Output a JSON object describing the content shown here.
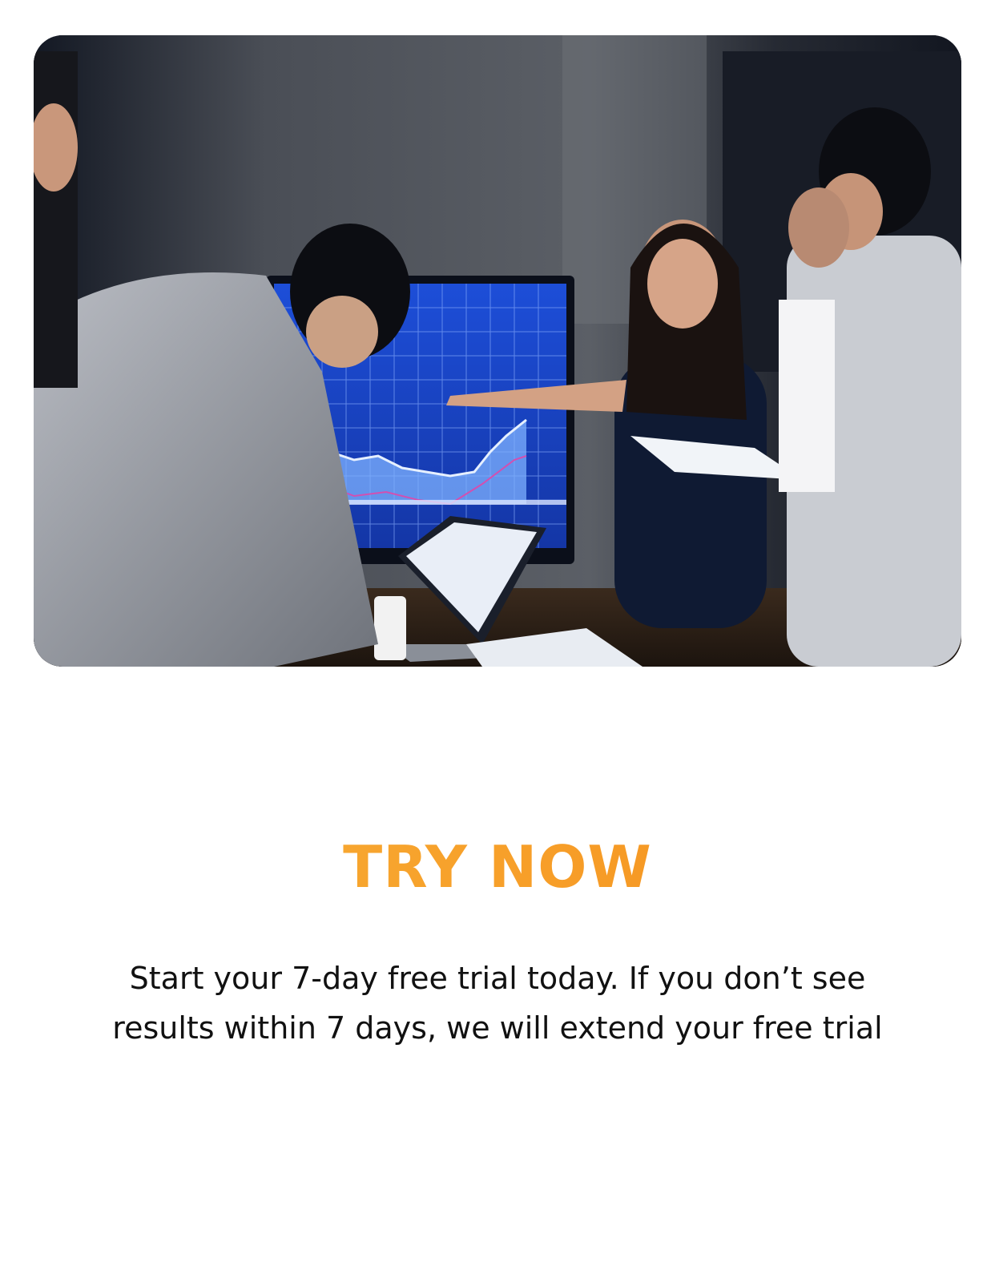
{
  "hero": {
    "image_icon": "business-meeting-photo-icon"
  },
  "cta": {
    "title": "TRY NOW",
    "description_lines": [
      "Start your 7-day free trial today. If you don’t see",
      "results within 7 days, we will extend your free trial"
    ]
  },
  "colors": {
    "accent_start": "#f8b23a",
    "accent_end": "#f58c1a",
    "text": "#111111",
    "background": "#ffffff"
  }
}
